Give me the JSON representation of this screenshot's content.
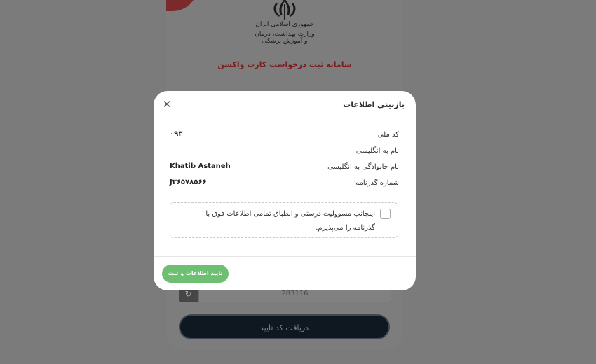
{
  "background": {
    "ministry_line1": "جمهوری اسلامی ایران",
    "ministry_line2": "وزارت بهداشت، درمان و آموزش پزشکی",
    "system_title": "سامانه ثبت درخواست کارت واکسن",
    "captcha_value": "283116",
    "get_code_label": "دریافت کد تایید"
  },
  "modal": {
    "title": "بازبینی اطلاعات",
    "rows": [
      {
        "label": "کد ملی",
        "value": "۰۹۳"
      },
      {
        "label": "نام به انگلیسی",
        "value": ""
      },
      {
        "label": "نام خانوادگی به انگلیسی",
        "value": "Khatib Astaneh"
      },
      {
        "label": "شماره گذرنامه",
        "value": "J۳۶۵۷۸۵۶۶"
      }
    ],
    "confirm_text": "اینجانب مسوولیت درستی و انطباق تمامی اطلاعات فوق با گذرنامه را می‌پذیرم.",
    "submit_label": "تایید اطلاعات و ثبت"
  }
}
